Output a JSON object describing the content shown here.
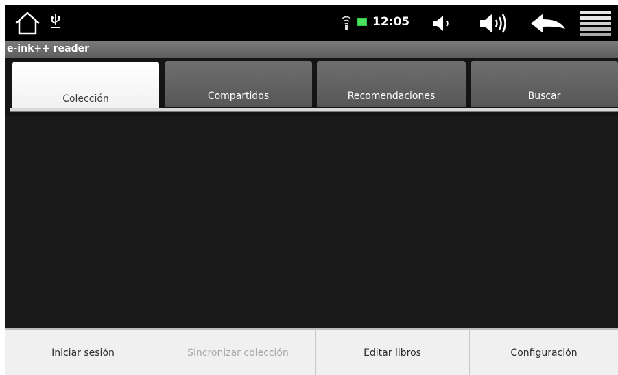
{
  "status_bar": {
    "time": "12:05",
    "icons": [
      "home-icon",
      "usb-icon",
      "wifi-icon",
      "battery-icon",
      "volume-down-icon",
      "volume-up-icon",
      "back-icon",
      "menu-icon"
    ],
    "battery_color": "#2ecc40"
  },
  "app": {
    "title": "e-ink++ reader"
  },
  "tabs": [
    {
      "label": "Colección",
      "active": true
    },
    {
      "label": "Compartidos",
      "active": false
    },
    {
      "label": "Recomendaciones",
      "active": false
    },
    {
      "label": "Buscar",
      "active": false
    }
  ],
  "bottom_menu": [
    {
      "label": "Iniciar sesión",
      "enabled": true
    },
    {
      "label": "Sincronizar colección",
      "enabled": false
    },
    {
      "label": "Editar libros",
      "enabled": true
    },
    {
      "label": "Configuración",
      "enabled": true
    }
  ]
}
